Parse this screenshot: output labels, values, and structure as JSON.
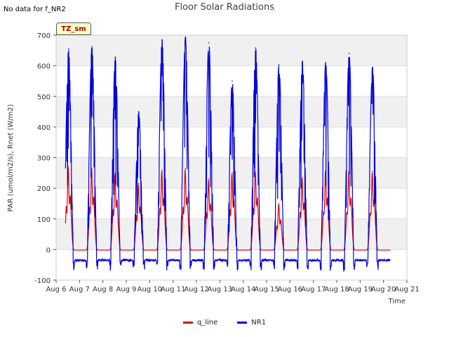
{
  "header": {
    "nodata_text": "No data for f_NR2",
    "title": "Floor Solar Radiations"
  },
  "annotation": {
    "label": "TZ_sm"
  },
  "chart_data": {
    "type": "line",
    "title": "Floor Solar Radiations",
    "xlabel": "Time",
    "ylabel": "PAR (umol/m2/s), Rnet (W/m2)",
    "xlim": [
      6,
      21
    ],
    "ylim": [
      -100,
      700
    ],
    "yticks": [
      -100,
      0,
      100,
      200,
      300,
      400,
      500,
      600,
      700
    ],
    "xtick_labels": [
      "Aug 6",
      "Aug 7",
      "Aug 8",
      "Aug 9",
      "Aug 10",
      "Aug 11",
      "Aug 12",
      "Aug 13",
      "Aug 14",
      "Aug 15",
      "Aug 16",
      "Aug 17",
      "Aug 18",
      "Aug 19",
      "Aug 20",
      "Aug 21"
    ],
    "grid": true,
    "legend_position": "bottom",
    "daily_peaks": [
      {
        "day": 6,
        "NR1": 655,
        "q_line": 270
      },
      {
        "day": 7,
        "NR1": 662,
        "q_line": 265
      },
      {
        "day": 8,
        "NR1": 628,
        "q_line": 250
      },
      {
        "day": 9,
        "NR1": 450,
        "q_line": 215
      },
      {
        "day": 10,
        "NR1": 685,
        "q_line": 260
      },
      {
        "day": 11,
        "NR1": 693,
        "q_line": 265
      },
      {
        "day": 12,
        "NR1": 675,
        "q_line": 230
      },
      {
        "day": 13,
        "NR1": 550,
        "q_line": 250
      },
      {
        "day": 14,
        "NR1": 658,
        "q_line": 260
      },
      {
        "day": 15,
        "NR1": 603,
        "q_line": 150
      },
      {
        "day": 16,
        "NR1": 615,
        "q_line": 235
      },
      {
        "day": 17,
        "NR1": 610,
        "q_line": 260
      },
      {
        "day": 18,
        "NR1": 640,
        "q_line": 260
      },
      {
        "day": 19,
        "NR1": 595,
        "q_line": 255
      }
    ],
    "night_levels": {
      "NR1": -35,
      "q_line": -2
    },
    "x_range": [
      6.4,
      20.3
    ],
    "series": [
      {
        "name": "q_line",
        "color": "#dd0000"
      },
      {
        "name": "NR1",
        "color": "#0000dd"
      }
    ]
  }
}
